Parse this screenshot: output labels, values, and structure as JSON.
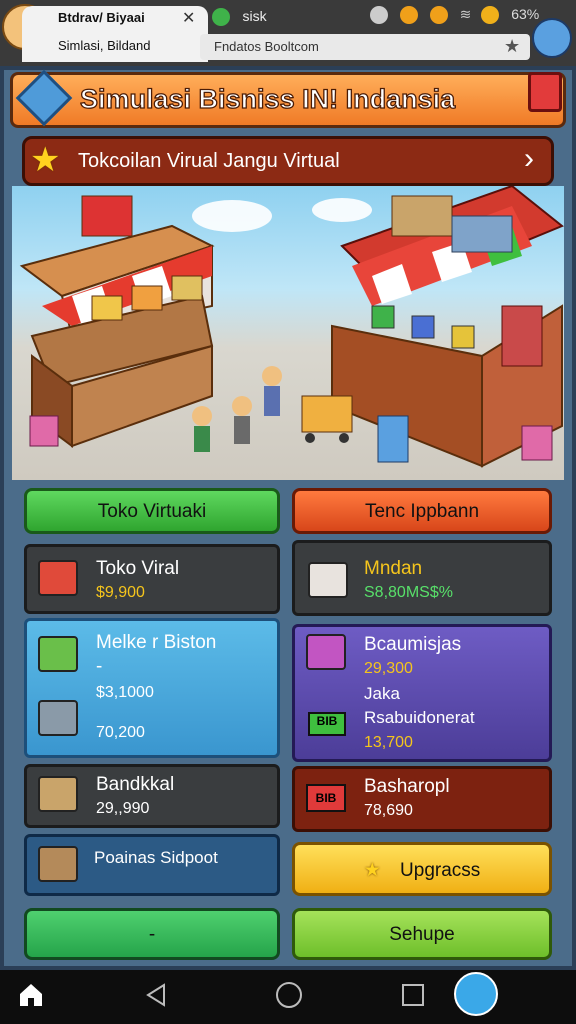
{
  "browser": {
    "tab1_title": "Btdrav/ Biyaai",
    "tab1_sub": "Simlasi, Bildand",
    "tab2_title": "sisk",
    "url": "Fndatos Booltcom",
    "battery": "63%"
  },
  "game": {
    "title": "Simulasi Bisniss IN! Indansia",
    "banner": "Tokcoilan Virual Jangu Virtual",
    "buttons": {
      "left": "Toko Virtuaki",
      "right": "Tenc Ippbann",
      "upgrade": "Upgracss",
      "bottom_left": "-",
      "bottom_right": "Sehupe"
    },
    "cards": [
      {
        "title": "Toko Viral",
        "value": "$9,900"
      },
      {
        "title": "Mndan",
        "value": "S8,80MS$%"
      },
      {
        "title": "Melke r Biston",
        "line2": "-",
        "value": "$3,1000",
        "value2": "70,200"
      },
      {
        "title": "Bcaumisjas",
        "value": "29,300",
        "line2": "Jaka",
        "line3": "Rsabuidonerat",
        "value2": "13,700",
        "tag": "BIB"
      },
      {
        "title": "Bandkkal",
        "value": "29,,990"
      },
      {
        "title": "Basharopl",
        "value": "78,690",
        "tag": "BIB"
      },
      {
        "title": "Poainas Sidpoot"
      }
    ]
  },
  "colors": {
    "green": "#3fbf3f",
    "orange": "#e8501e",
    "blue_card": "#49a8d8",
    "purple_card": "#5b4aa8",
    "dark_card": "#3a3d3f",
    "red_card": "#7d2210",
    "yellow": "#f5c51c",
    "lime": "#8dd13e"
  }
}
